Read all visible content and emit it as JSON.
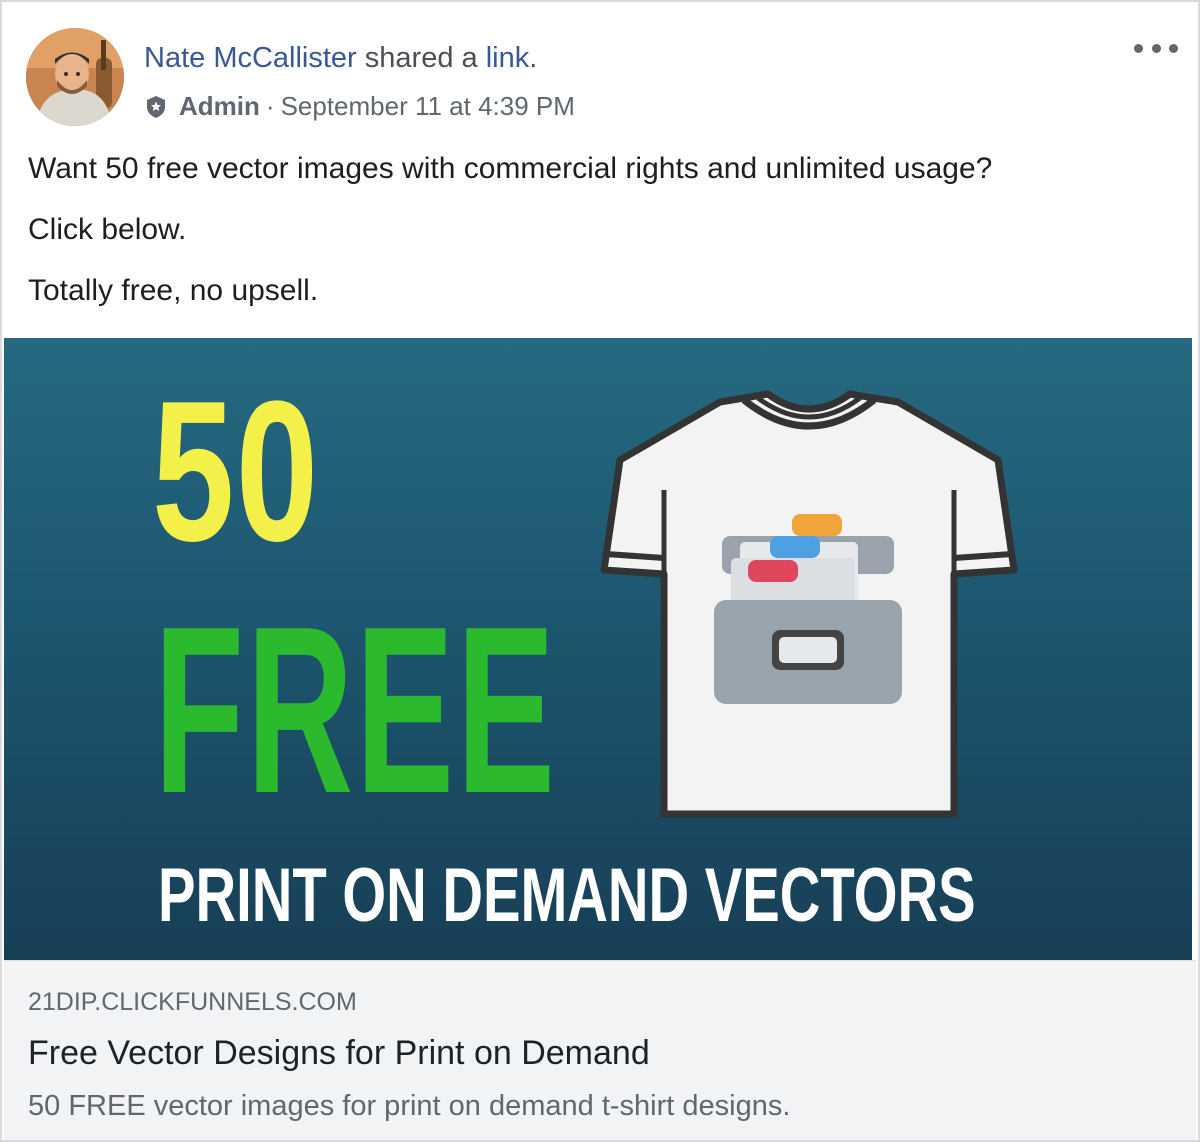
{
  "post": {
    "author_name": "Nate McCallister",
    "action_text": " shared a ",
    "action_link": "link",
    "action_end": ".",
    "role_label": "Admin",
    "separator": "·",
    "timestamp": "September 11 at 4:39 PM",
    "more_icon": "more-horizontal-icon",
    "admin_icon": "admin-badge-icon",
    "paragraphs": [
      "Want 50 free vector images with commercial rights and unlimited usage?",
      "Click below.",
      "Totally free, no upsell."
    ]
  },
  "banner": {
    "line1": "50",
    "line2": "FREE",
    "line3": "PRINT ON DEMAND VECTORS",
    "colors": {
      "line1": "#f4f04a",
      "line2": "#2bba2e",
      "line3": "#ffffff",
      "background_top": "#256a80",
      "background_bottom": "#173f56"
    }
  },
  "link_preview": {
    "domain": "21DIP.CLICKFUNNELS.COM",
    "title": "Free Vector Designs for Print on Demand",
    "description": "50 FREE vector images for print on demand t-shirt designs."
  },
  "colors": {
    "link_blue": "#385898",
    "meta_gray": "#606770",
    "footer_bg": "#f2f3f5"
  }
}
